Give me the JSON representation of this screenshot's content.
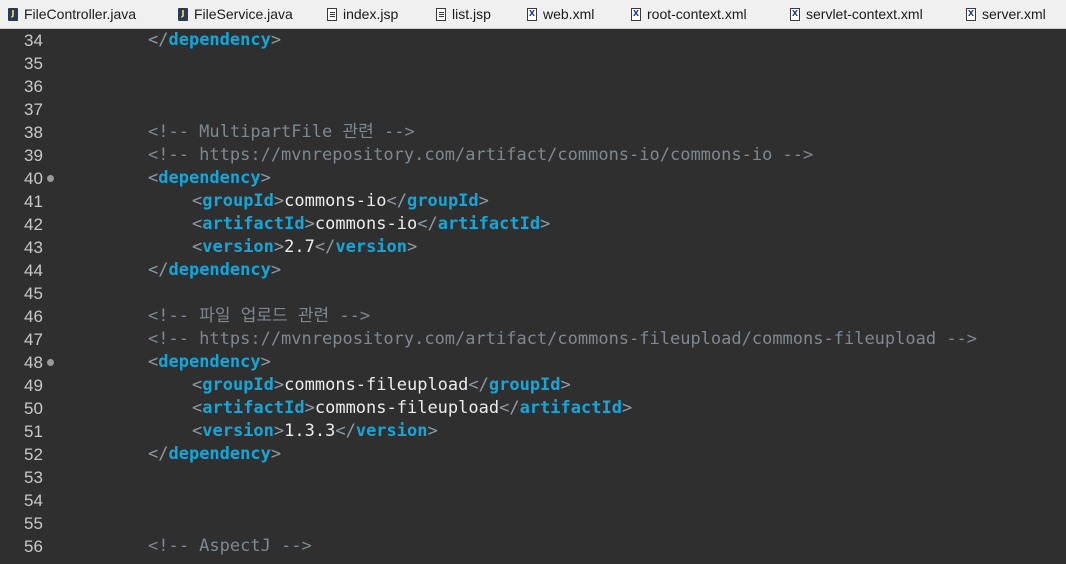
{
  "tabs": [
    {
      "label": "FileController.java",
      "icon": "java-file-icon",
      "icon_glyph": "J"
    },
    {
      "label": "FileService.java",
      "icon": "java-file-icon",
      "icon_glyph": "J"
    },
    {
      "label": "index.jsp",
      "icon": "jsp-file-icon",
      "icon_glyph": ""
    },
    {
      "label": "list.jsp",
      "icon": "jsp-file-icon",
      "icon_glyph": ""
    },
    {
      "label": "web.xml",
      "icon": "xml-file-icon",
      "icon_glyph": "X"
    },
    {
      "label": "root-context.xml",
      "icon": "xml-file-icon",
      "icon_glyph": "X"
    },
    {
      "label": "servlet-context.xml",
      "icon": "xml-file-icon",
      "icon_glyph": "X"
    },
    {
      "label": "server.xml",
      "icon": "xml-file-icon",
      "icon_glyph": "X"
    }
  ],
  "lines": [
    {
      "num": "34",
      "kind": "close",
      "tag": "dependency"
    },
    {
      "num": "35",
      "kind": "blank"
    },
    {
      "num": "36",
      "kind": "blank"
    },
    {
      "num": "37",
      "kind": "blank"
    },
    {
      "num": "38",
      "kind": "comment",
      "text": "<!-- MultipartFile 관련 -->"
    },
    {
      "num": "39",
      "kind": "comment",
      "text": "<!-- https://mvnrepository.com/artifact/commons-io/commons-io -->"
    },
    {
      "num": "40",
      "kind": "open",
      "tag": "dependency",
      "fold": true
    },
    {
      "num": "41",
      "kind": "element",
      "tag": "groupId",
      "value": "commons-io"
    },
    {
      "num": "42",
      "kind": "element",
      "tag": "artifactId",
      "value": "commons-io"
    },
    {
      "num": "43",
      "kind": "element",
      "tag": "version",
      "value": "2.7"
    },
    {
      "num": "44",
      "kind": "close",
      "tag": "dependency"
    },
    {
      "num": "45",
      "kind": "blank"
    },
    {
      "num": "46",
      "kind": "comment",
      "text": "<!-- 파일 업로드 관련 -->"
    },
    {
      "num": "47",
      "kind": "comment",
      "text": "<!-- https://mvnrepository.com/artifact/commons-fileupload/commons-fileupload -->"
    },
    {
      "num": "48",
      "kind": "open",
      "tag": "dependency",
      "fold": true
    },
    {
      "num": "49",
      "kind": "element",
      "tag": "groupId",
      "value": "commons-fileupload"
    },
    {
      "num": "50",
      "kind": "element",
      "tag": "artifactId",
      "value": "commons-fileupload"
    },
    {
      "num": "51",
      "kind": "element",
      "tag": "version",
      "value": "1.3.3"
    },
    {
      "num": "52",
      "kind": "close",
      "tag": "dependency"
    },
    {
      "num": "53",
      "kind": "blank"
    },
    {
      "num": "54",
      "kind": "blank"
    },
    {
      "num": "55",
      "kind": "blank"
    },
    {
      "num": "56",
      "kind": "comment",
      "text": "<!-- AspectJ -->"
    }
  ]
}
